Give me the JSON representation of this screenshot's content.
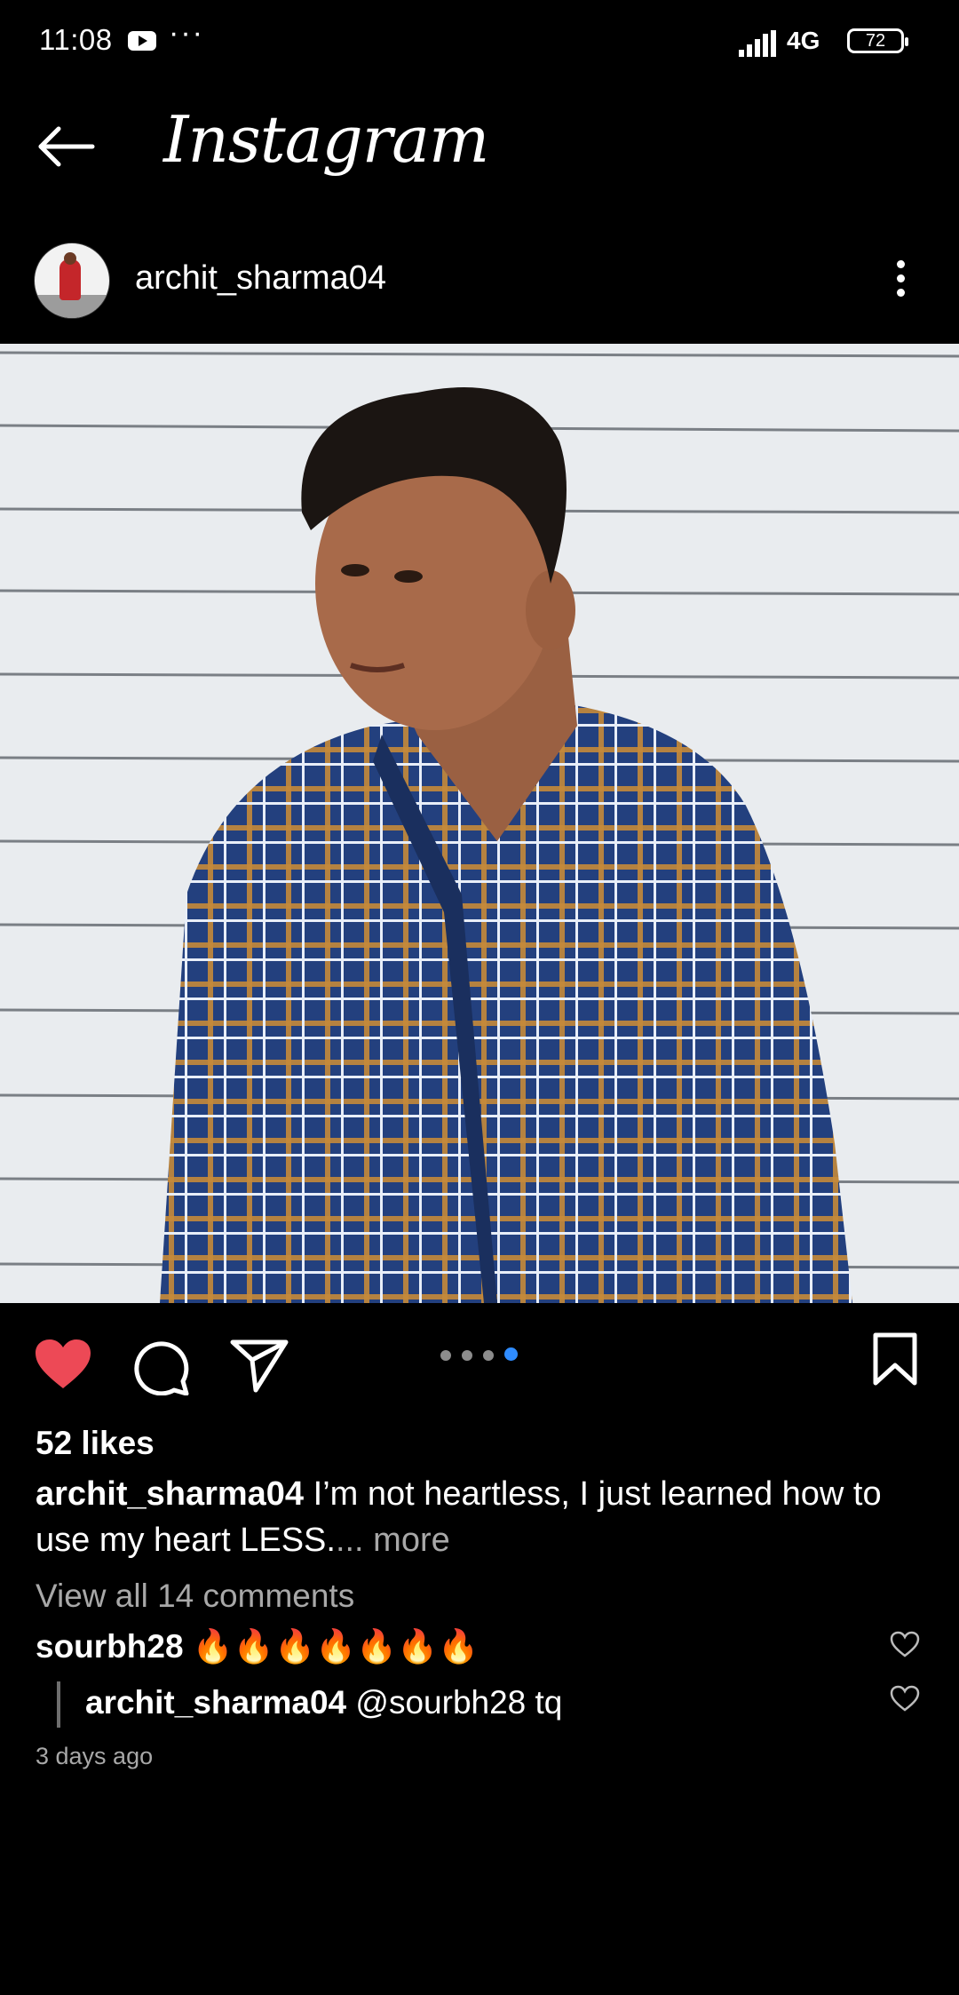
{
  "status_bar": {
    "time": "11:08",
    "overflow": "···",
    "network": "4G",
    "battery": "72",
    "icons": [
      "youtube-icon",
      "signal-icon",
      "battery-icon"
    ]
  },
  "app_bar": {
    "title": "Instagram",
    "back_icon": "back-arrow-icon"
  },
  "post": {
    "username": "archit_sharma04",
    "image_icon": "post-photo",
    "carousel": {
      "count": 4,
      "active_index": 3
    },
    "liked": true,
    "likes": "52 likes",
    "caption": {
      "user": "archit_sharma04",
      "text": " I’m not heartless, I just learned how to use my heart LESS.",
      "more": "... more"
    },
    "view_all_comments": "View all 14 comments",
    "comments": [
      {
        "user": "sourbh28",
        "text": " 🔥🔥🔥🔥🔥🔥🔥"
      }
    ],
    "replies": [
      {
        "user": "archit_sharma04",
        "text": " @sourbh28 tq"
      }
    ],
    "time_ago": "3 days ago"
  },
  "colors": {
    "background": "#000000",
    "like_red": "#ed4956",
    "secondary_text": "#a8a8a8",
    "carousel_active": "#2f8cff"
  }
}
